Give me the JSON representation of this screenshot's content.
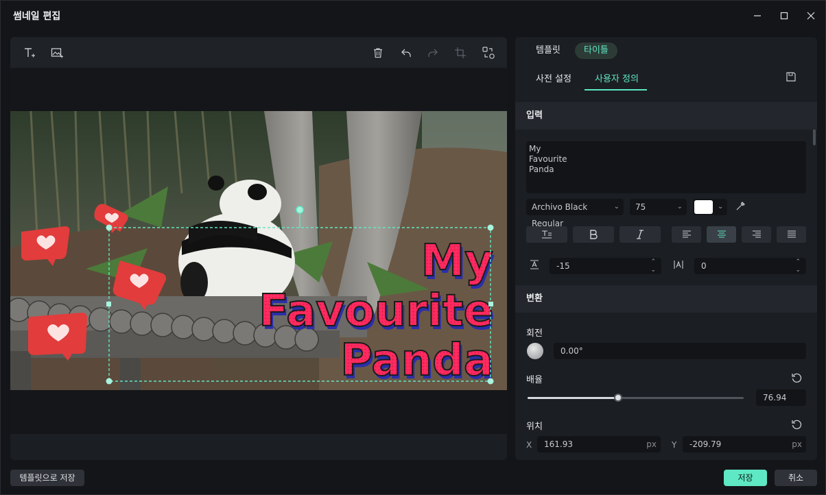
{
  "window": {
    "title": "썸네일 편집"
  },
  "left_toolbar": {
    "icons": [
      "add-text-icon",
      "add-image-icon",
      "delete-icon",
      "undo-icon",
      "redo-icon",
      "crop-icon",
      "replace-icon"
    ]
  },
  "canvas": {
    "title_lines": [
      "My",
      "Favourite",
      "Panda"
    ]
  },
  "right": {
    "tabs": [
      "템플릿",
      "타이틀"
    ],
    "active_tab": "타이틀",
    "subtabs": [
      "사전 설정",
      "사용자 정의"
    ],
    "active_subtab": "사용자 정의",
    "input_section": "입력",
    "text_lines": [
      "My",
      "Favourite",
      "Panda"
    ],
    "font": "Archivo Black Regular",
    "font_size": "75",
    "text_color": "#ffffff",
    "line_spacing": "-15",
    "char_spacing": "0",
    "transform_section": "변환",
    "rotation_label": "회전",
    "rotation_value": "0.00°",
    "scale_label": "배율",
    "scale_value": "76.94",
    "scale_fraction": 0.42,
    "position_label": "위치",
    "x_label": "X",
    "x_value": "161.93",
    "y_label": "Y",
    "y_value": "-209.79",
    "unit": "px"
  },
  "footer": {
    "save_template": "템플릿으로 저장",
    "save": "저장",
    "cancel": "취소"
  },
  "colors": {
    "accent": "#5ee8c3",
    "title_fill": "#ff2a5f",
    "title_shadow": "#2a2fa8"
  }
}
